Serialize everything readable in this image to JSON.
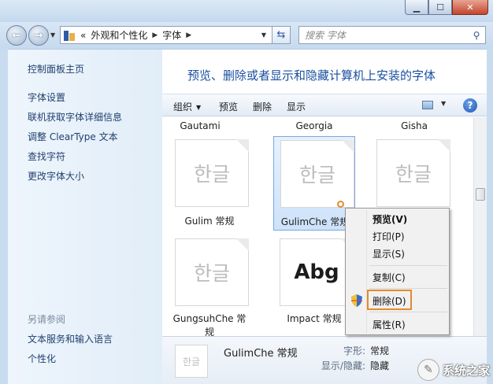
{
  "window": {
    "minimize_icon": "minimize-icon",
    "maximize_icon": "maximize-icon",
    "close_icon": "close-icon"
  },
  "nav": {
    "back_icon": "back-arrow-icon",
    "forward_icon": "forward-arrow-icon",
    "address": {
      "overflow": "«",
      "parts": [
        "外观和个性化",
        "字体"
      ]
    },
    "refresh_icon": "refresh-icon",
    "search_placeholder": "搜索 字体"
  },
  "sidebar": {
    "home": "控制面板主页",
    "links": [
      "字体设置",
      "联机获取字体详细信息",
      "调整 ClearType 文本",
      "查找字符",
      "更改字体大小"
    ],
    "see_also_heading": "另请参阅",
    "see_also": [
      "文本服务和输入语言",
      "个性化"
    ]
  },
  "main": {
    "title": "预览、删除或者显示和隐藏计算机上安装的字体"
  },
  "toolbar": {
    "organize": "组织",
    "preview": "预览",
    "delete": "删除",
    "show": "显示",
    "help_icon": "help-icon"
  },
  "fonts_top_row": [
    "Gautami",
    "Georgia",
    "Gisha"
  ],
  "font_tiles": [
    {
      "glyph": "한글",
      "label": "Gulim 常规"
    },
    {
      "glyph": "한글",
      "label": "GulimChe 常规",
      "selected": true
    },
    {
      "glyph": "한글",
      "label": ""
    },
    {
      "glyph": "한글",
      "label": "GungsuhChe 常规"
    },
    {
      "glyph": "Abg",
      "label": "Impact 常规"
    }
  ],
  "context_menu": {
    "items": [
      "预览(V)",
      "打印(P)",
      "显示(S)",
      "复制(C)",
      "删除(D)",
      "属性(R)"
    ],
    "shield_icon": "uac-shield-icon"
  },
  "details": {
    "thumb_glyph": "한글",
    "name": "GulimChe 常规",
    "style_key": "字形:",
    "style_value": "常规",
    "visibility_key": "显示/隐藏:",
    "visibility_value": "隐藏"
  },
  "watermark": "系统之家"
}
